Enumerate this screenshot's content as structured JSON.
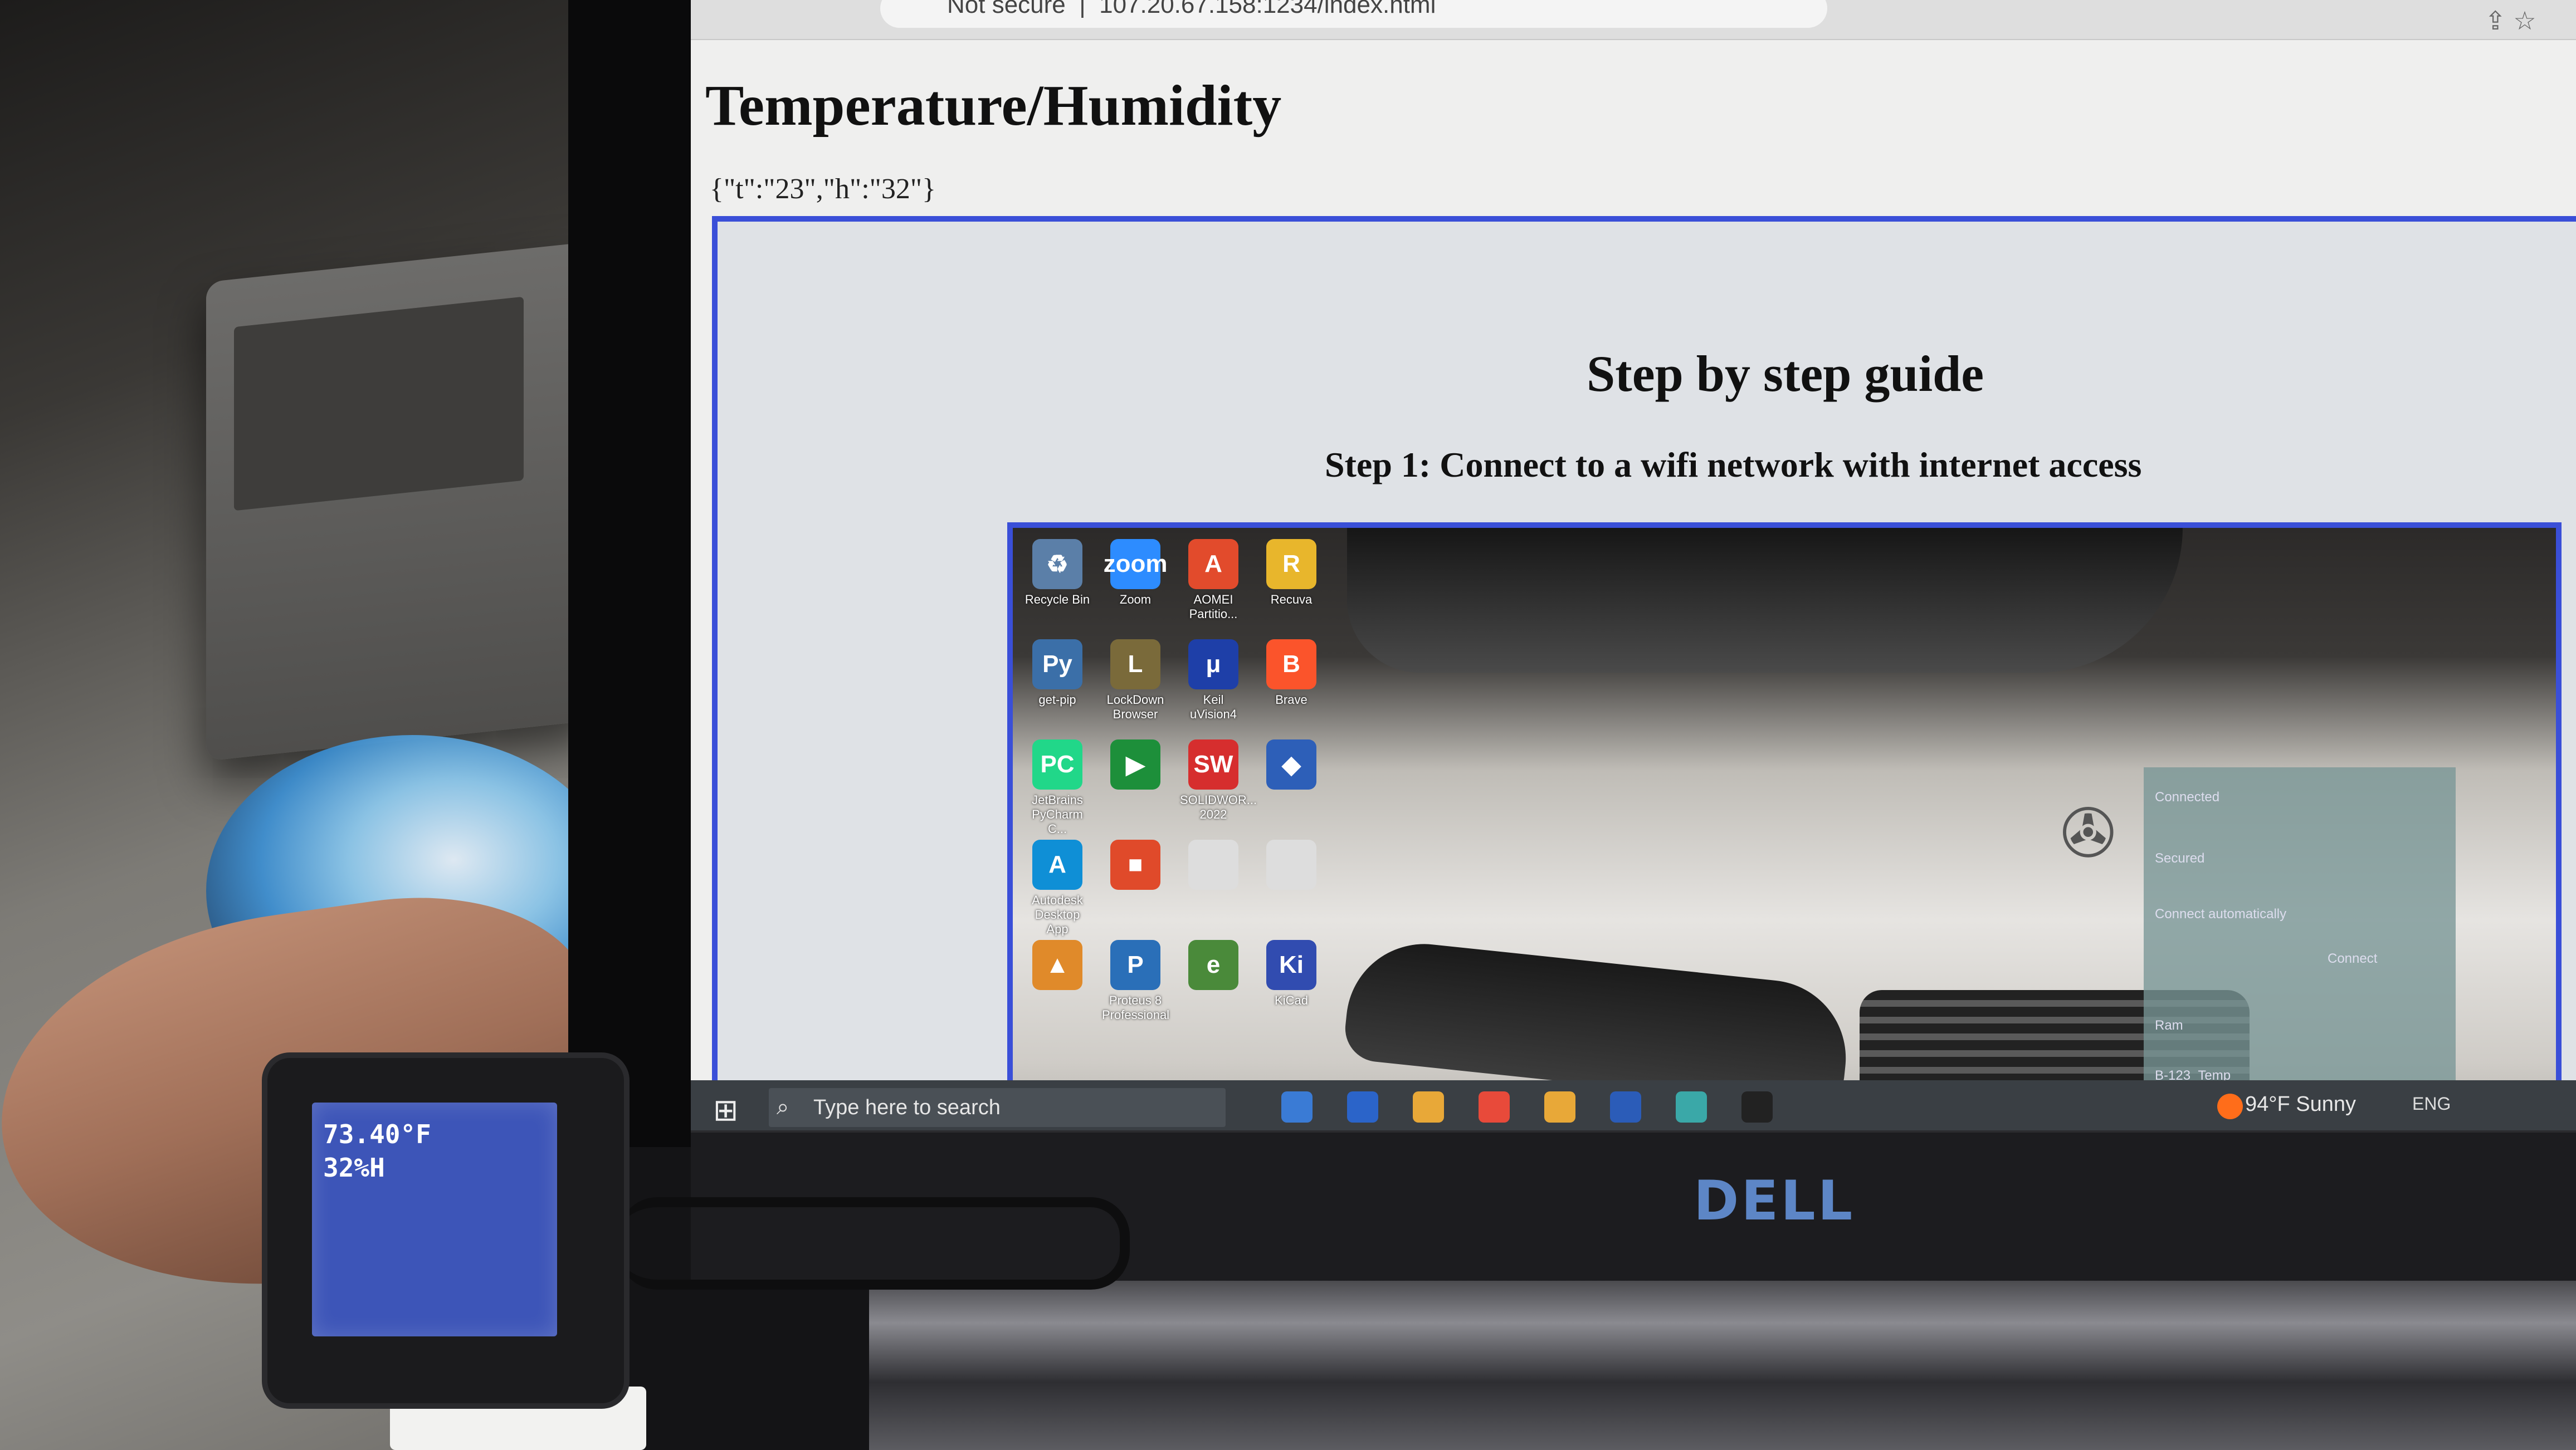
{
  "browser": {
    "address": "107.20.67.158:1234/index.html",
    "security_label": "Not secure"
  },
  "page": {
    "title": "Temperature/Humidity",
    "json_readout": "{\"t\":\"23\",\"h\":\"32\"}"
  },
  "guide": {
    "title": "Step by step guide",
    "step": "Step 1: Connect to a wifi network with internet access"
  },
  "desktop_icons": [
    {
      "label": "Recycle Bin",
      "glyph": "♻",
      "color": "#5b7fa8"
    },
    {
      "label": "Zoom",
      "glyph": "zoom",
      "color": "#2d8cff"
    },
    {
      "label": "AOMEI Partitio...",
      "glyph": "A",
      "color": "#e24b2c"
    },
    {
      "label": "Recuva",
      "glyph": "R",
      "color": "#e8b62c"
    },
    {
      "label": "get-pip",
      "glyph": "Py",
      "color": "#3b6fa8"
    },
    {
      "label": "LockDown Browser",
      "glyph": "L",
      "color": "#7a6a3a"
    },
    {
      "label": "Keil uVision4",
      "glyph": "μ",
      "color": "#1e3fa8"
    },
    {
      "label": "Brave",
      "glyph": "B",
      "color": "#fb542b"
    },
    {
      "label": "JetBrains PyCharm C...",
      "glyph": "PC",
      "color": "#21d789"
    },
    {
      "label": "",
      "glyph": "▶",
      "color": "#1d8f3a"
    },
    {
      "label": "SOLIDWOR... 2022",
      "glyph": "SW",
      "color": "#d62e2e"
    },
    {
      "label": "",
      "glyph": "◆",
      "color": "#2d5fb8"
    },
    {
      "label": "Autodesk Desktop App",
      "glyph": "A",
      "color": "#0f8fd6"
    },
    {
      "label": "",
      "glyph": "■",
      "color": "#e04a2a"
    },
    {
      "label": "",
      "glyph": "",
      "color": "#dddddd"
    },
    {
      "label": "",
      "glyph": "",
      "color": "#dddddd"
    },
    {
      "label": "",
      "glyph": "▲",
      "color": "#e08a2a"
    },
    {
      "label": "Proteus 8 Professional",
      "glyph": "P",
      "color": "#2a6fb8"
    },
    {
      "label": "",
      "glyph": "e",
      "color": "#4a8a3a"
    },
    {
      "label": "KiCad",
      "glyph": "Ki",
      "color": "#314cb0"
    }
  ],
  "wifi": {
    "networks": [
      "Connected",
      "Secured",
      "Connect automatically",
      "Connect",
      "Ram",
      "B-123_Temp"
    ]
  },
  "taskbar": {
    "search_placeholder": "Type here to search",
    "weather": "94°F Sunny",
    "tray": "ENG",
    "apps": [
      "#3a7bd5",
      "#2b64c9",
      "#e8a838",
      "#e84a3a",
      "#e8a838",
      "#2b5cb8",
      "#3aa8a8",
      "#222222"
    ]
  },
  "sensor": {
    "line1": "73.40°F",
    "line2": "32%H"
  },
  "monitor": {
    "brand": "DELL"
  }
}
